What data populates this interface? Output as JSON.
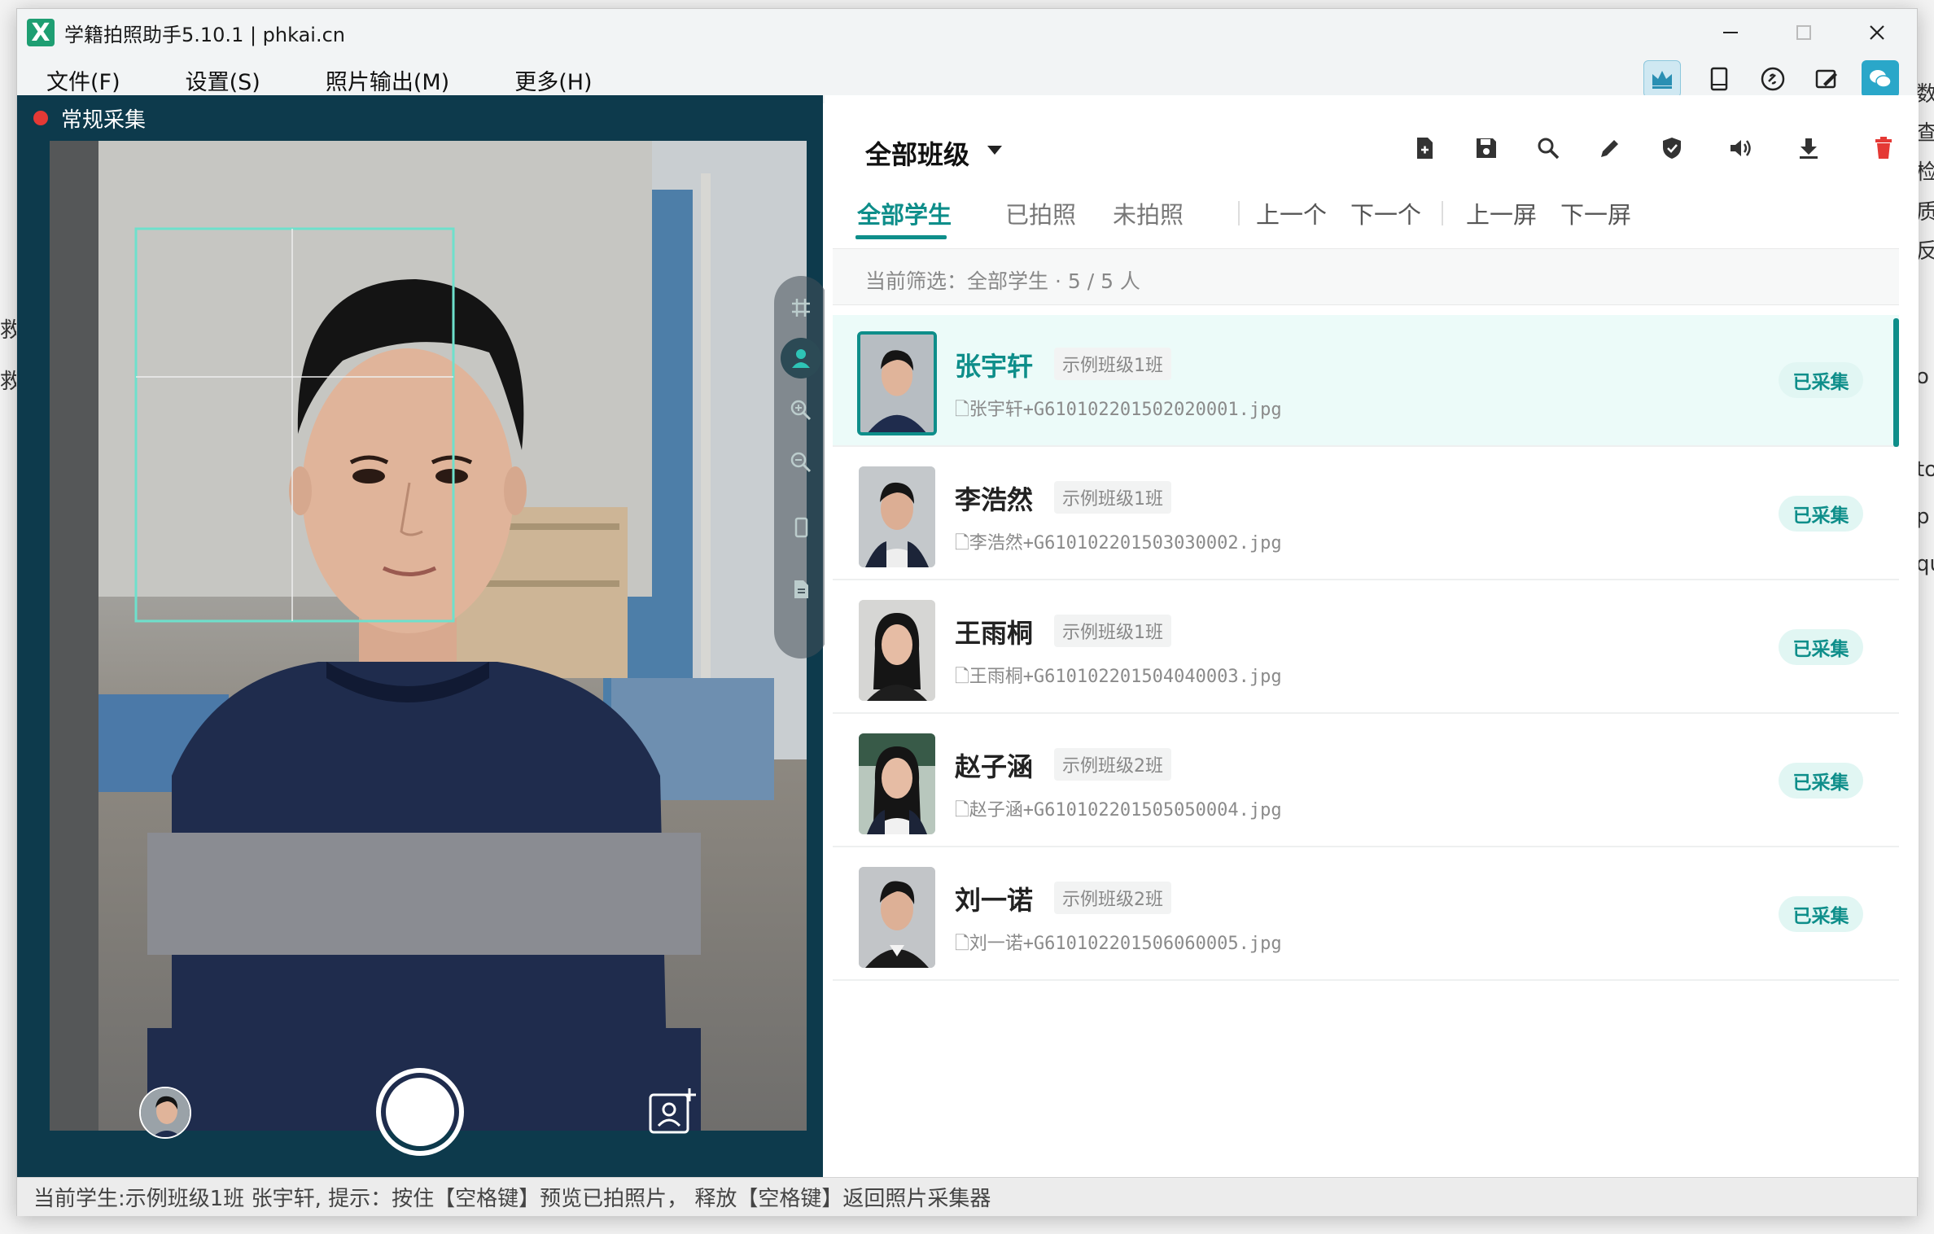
{
  "window": {
    "title": "学籍拍照助手5.10.1 | phkai.cn",
    "logo_letter": "X"
  },
  "menu": {
    "items": [
      "文件(F)",
      "设置(S)",
      "照片输出(M)",
      "更多(H)"
    ]
  },
  "toolbar_icons": [
    "crown-icon",
    "tablet-icon",
    "link-icon",
    "edit-image-icon",
    "wechat-icon"
  ],
  "camera": {
    "mode_label": "常规采集",
    "tools": [
      "grid-icon",
      "person-icon",
      "zoom-in-icon",
      "zoom-out-icon",
      "phone-icon",
      "document-icon"
    ],
    "active_tool": "person-icon"
  },
  "panel": {
    "class_selector": "全部班级",
    "action_icons": [
      "add-file-icon",
      "save-icon",
      "search-icon",
      "edit-icon",
      "shield-icon",
      "volume-icon",
      "download-icon",
      "delete-icon"
    ],
    "tabs": [
      "全部学生",
      "已拍照",
      "未拍照"
    ],
    "active_tab": "全部学生",
    "nav": [
      "上一个",
      "下一个",
      "上一屏",
      "下一屏"
    ],
    "filter_text": "当前筛选：全部学生 · 5 / 5 人",
    "accent_color": "#0e8e8a",
    "delete_color": "#e53935"
  },
  "students": [
    {
      "name": "张宇轩",
      "class": "示例班级1班",
      "file": "张宇轩+G610102201502020001.jpg",
      "status": "已采集",
      "selected": true
    },
    {
      "name": "李浩然",
      "class": "示例班级1班",
      "file": "李浩然+G610102201503030002.jpg",
      "status": "已采集",
      "selected": false
    },
    {
      "name": "王雨桐",
      "class": "示例班级1班",
      "file": "王雨桐+G610102201504040003.jpg",
      "status": "已采集",
      "selected": false
    },
    {
      "name": "赵子涵",
      "class": "示例班级2班",
      "file": "赵子涵+G610102201505050004.jpg",
      "status": "已采集",
      "selected": false
    },
    {
      "name": "刘一诺",
      "class": "示例班级2班",
      "file": "刘一诺+G610102201506060005.jpg",
      "status": "已采集",
      "selected": false
    }
  ],
  "status_bar": "当前学生:示例班级1班 张宇轩, 提示：按住【空格键】预览已拍照片， 释放【空格键】返回照片采集器",
  "background_fragments": [
    "数",
    "查",
    "检",
    "质",
    "反",
    "救",
    "救",
    "o",
    "to",
    "p",
    "qu"
  ]
}
